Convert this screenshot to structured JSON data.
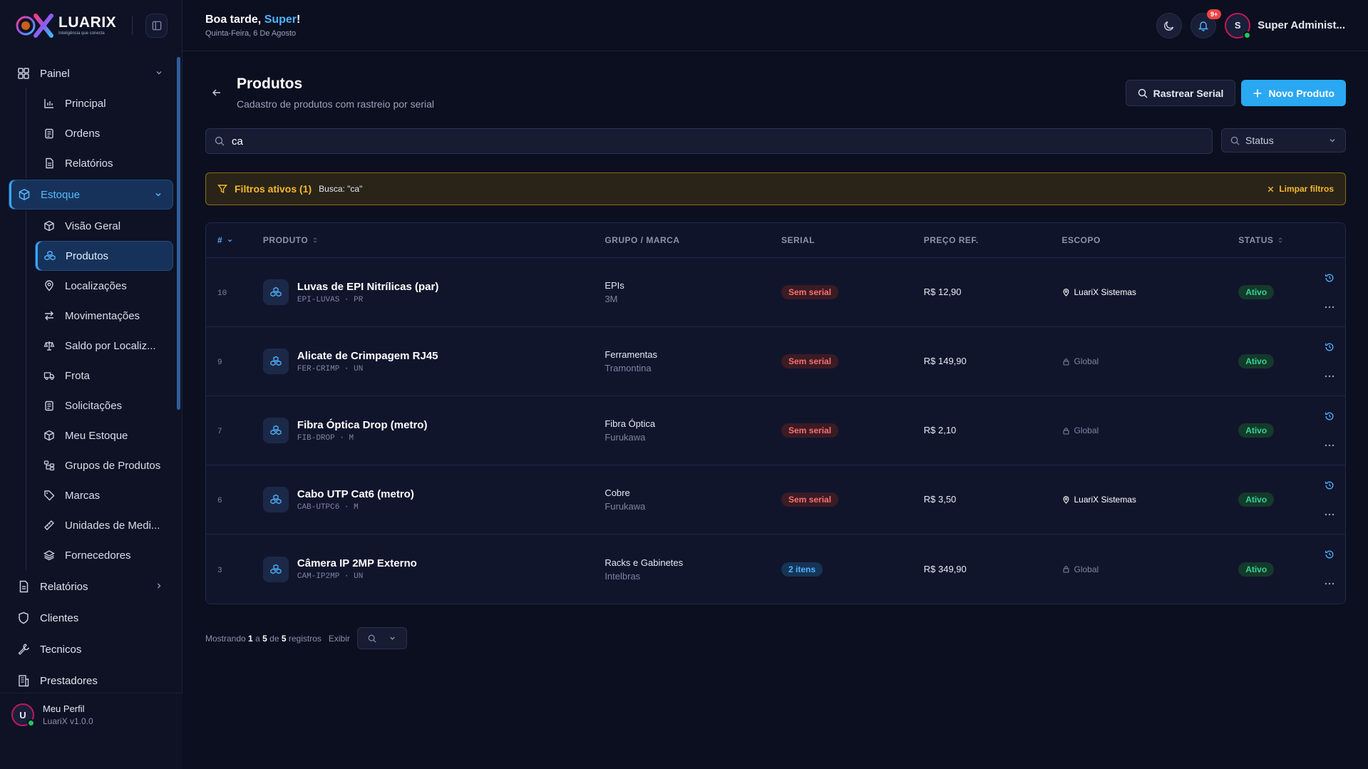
{
  "app": {
    "logo_name": "LUARIX",
    "logo_tagline": "Inteligência que conecta"
  },
  "header": {
    "greeting_prefix": "Boa tarde, ",
    "greeting_name": "Super",
    "greeting_suffix": "!",
    "date": "Quinta-Feira, 6 De Agosto",
    "notifications_badge": "9+",
    "user_initial": "S",
    "user_name": "Super Administ..."
  },
  "sidebar": {
    "painel": {
      "label": "Painel",
      "items": [
        "Principal",
        "Ordens",
        "Relatórios"
      ]
    },
    "estoque": {
      "label": "Estoque",
      "items": [
        "Visão Geral",
        "Produtos",
        "Localizações",
        "Movimentações",
        "Saldo por Localiz...",
        "Frota",
        "Solicitações",
        "Meu Estoque",
        "Grupos de Produtos",
        "Marcas",
        "Unidades de Medi...",
        "Fornecedores"
      ],
      "active_index": 1
    },
    "bottom_items": [
      "Relatórios",
      "Clientes",
      "Tecnicos",
      "Prestadores"
    ],
    "profile": {
      "initial": "U",
      "name": "Meu Perfil",
      "version": "LuariX v1.0.0"
    }
  },
  "page": {
    "title": "Produtos",
    "subtitle": "Cadastro de produtos com rastreio por serial",
    "btn_track": "Rastrear Serial",
    "btn_new": "Novo Produto",
    "search_value": "ca",
    "status_placeholder": "Status",
    "filter_title": "Filtros ativos (1)",
    "filter_chip": "Busca: \"ca\"",
    "filter_clear": "Limpar filtros"
  },
  "table": {
    "columns": [
      "#",
      "PRODUTO",
      "GRUPO / MARCA",
      "SERIAL",
      "PREÇO REF.",
      "ESCOPO",
      "STATUS"
    ],
    "rows": [
      {
        "id": "10",
        "name": "Luvas de EPI Nitrílicas (par)",
        "code": "EPI-LUVAS · PR",
        "group": "EPIs",
        "brand": "3M",
        "serial": "Sem serial",
        "serial_kind": "none",
        "price": "R$ 12,90",
        "scope": "LuariX Sistemas",
        "scope_kind": "org",
        "status": "Ativo"
      },
      {
        "id": "9",
        "name": "Alicate de Crimpagem RJ45",
        "code": "FER-CRIMP · UN",
        "group": "Ferramentas",
        "brand": "Tramontina",
        "serial": "Sem serial",
        "serial_kind": "none",
        "price": "R$ 149,90",
        "scope": "Global",
        "scope_kind": "global",
        "status": "Ativo"
      },
      {
        "id": "7",
        "name": "Fibra Óptica Drop (metro)",
        "code": "FIB-DROP · M",
        "group": "Fibra Óptica",
        "brand": "Furukawa",
        "serial": "Sem serial",
        "serial_kind": "none",
        "price": "R$ 2,10",
        "scope": "Global",
        "scope_kind": "global",
        "status": "Ativo"
      },
      {
        "id": "6",
        "name": "Cabo UTP Cat6 (metro)",
        "code": "CAB-UTPC6 · M",
        "group": "Cobre",
        "brand": "Furukawa",
        "serial": "Sem serial",
        "serial_kind": "none",
        "price": "R$ 3,50",
        "scope": "LuariX Sistemas",
        "scope_kind": "org",
        "status": "Ativo"
      },
      {
        "id": "3",
        "name": "Câmera IP 2MP Externo",
        "code": "CAM-IP2MP · UN",
        "group": "Racks e Gabinetes",
        "brand": "Intelbras",
        "serial": "2 itens",
        "serial_kind": "items",
        "price": "R$ 349,90",
        "scope": "Global",
        "scope_kind": "global",
        "status": "Ativo"
      }
    ]
  },
  "pager": {
    "prefix": "Mostrando",
    "from": "1",
    "a": "a",
    "to": "5",
    "de": "de",
    "total": "5",
    "suffix": "registros",
    "show_label": "Exibir"
  }
}
